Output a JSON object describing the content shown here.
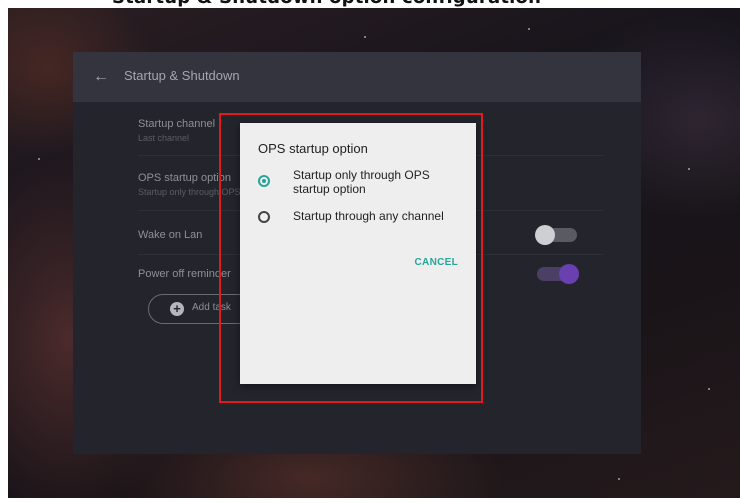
{
  "caption": {
    "text": "Startup & Shutdown option configuration"
  },
  "panel": {
    "title": "Startup & Shutdown",
    "items": [
      {
        "title": "Startup channel",
        "subtitle": "Last channel"
      },
      {
        "title": "OPS startup option",
        "subtitle": "Startup only through OPS startup option"
      },
      {
        "title": "Wake on Lan",
        "toggle": "off"
      },
      {
        "title": "Power off reminder",
        "toggle": "on"
      }
    ],
    "add_task_label": "Add task"
  },
  "dialog": {
    "title": "OPS startup option",
    "options": [
      {
        "label": "Startup only through OPS startup option",
        "selected": true
      },
      {
        "label": "Startup through any channel",
        "selected": false
      }
    ],
    "cancel_label": "CANCEL"
  },
  "colors": {
    "accent": "#26a69a",
    "toggle_on": "#6a3fb0",
    "highlight": "#e01b1b"
  }
}
